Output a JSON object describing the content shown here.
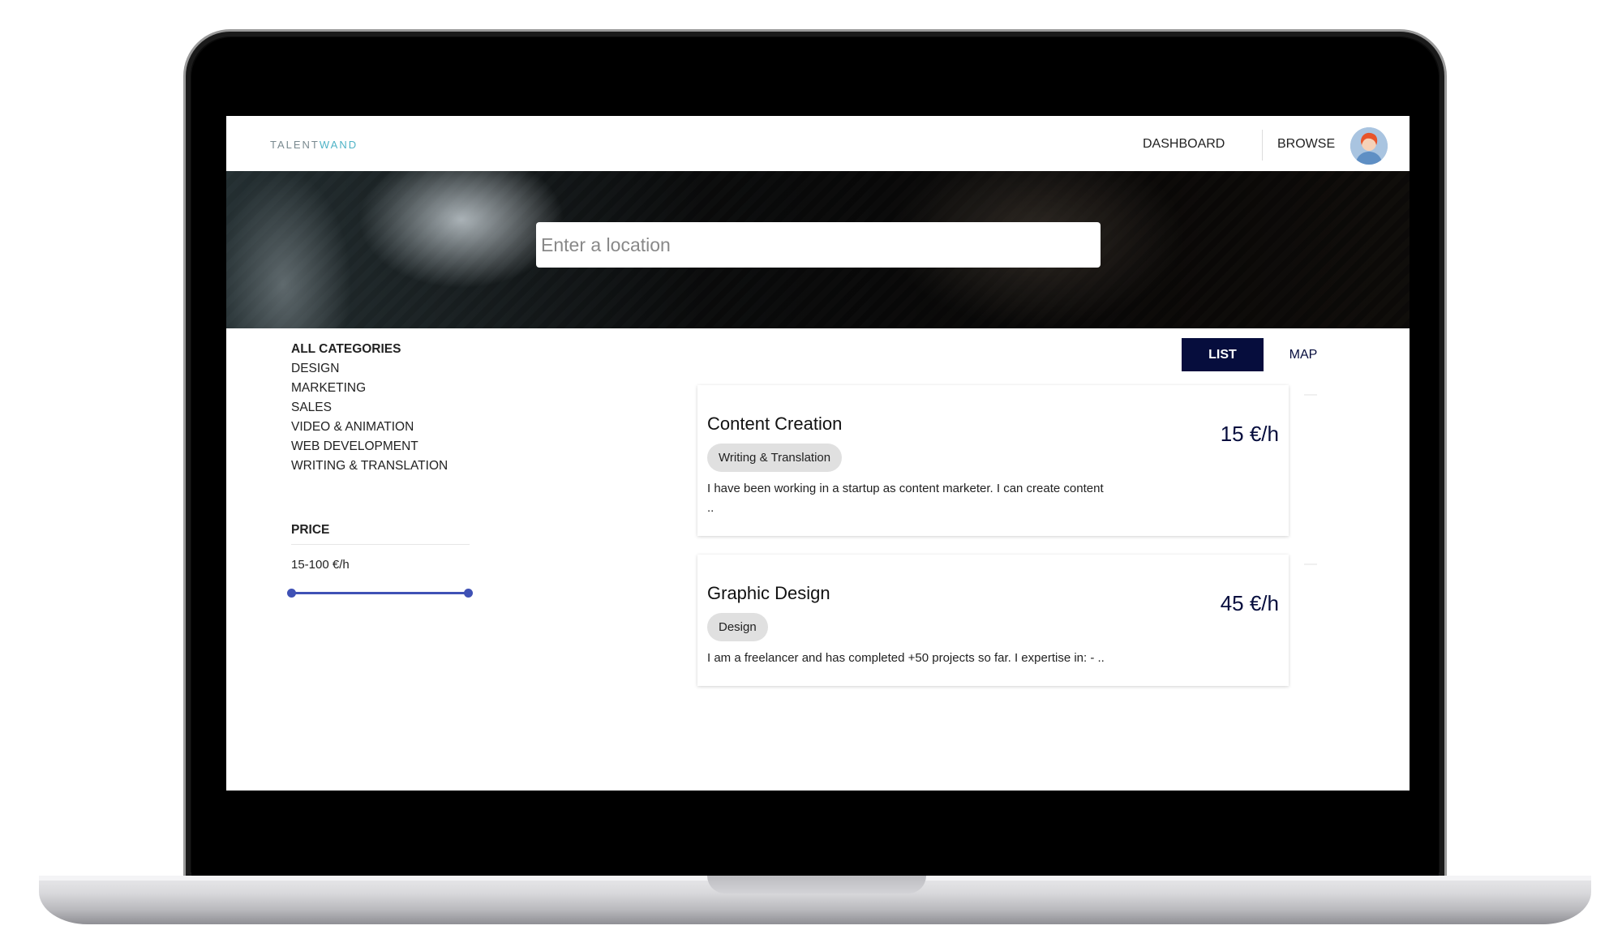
{
  "app": {
    "logo_part1": "TALENT",
    "logo_part2": "WAND"
  },
  "nav": {
    "dashboard": "DASHBOARD",
    "browse": "BROWSE"
  },
  "search": {
    "placeholder": "Enter a location",
    "value": ""
  },
  "sidebar": {
    "categories": [
      {
        "label": "ALL CATEGORIES",
        "active": true
      },
      {
        "label": "DESIGN"
      },
      {
        "label": "MARKETING"
      },
      {
        "label": "SALES"
      },
      {
        "label": "VIDEO & ANIMATION"
      },
      {
        "label": "WEB DEVELOPMENT"
      },
      {
        "label": "WRITING & TRANSLATION"
      }
    ],
    "price": {
      "title": "PRICE",
      "range_label": "15-100 €/h",
      "min_fraction": 0.0,
      "max_fraction": 1.0
    }
  },
  "view_toggle": {
    "list": "LIST",
    "map": "MAP",
    "selected": "LIST"
  },
  "listings": [
    {
      "title": "Content Creation",
      "price": "15 €/h",
      "tag": "Writing & Translation",
      "description_line1": "I have been working in a startup as content marketer. I can create content",
      "description_line2": ".."
    },
    {
      "title": "Graphic Design",
      "price": "45 €/h",
      "tag": "Design",
      "description_line1": "I am a freelancer and has completed +50 projects so far. I expertise in: - ..",
      "description_line2": ""
    }
  ],
  "colors": {
    "accent_navy": "#060d3d",
    "slider_blue": "#3f51b5",
    "logo_teal": "#4fb3c6"
  }
}
